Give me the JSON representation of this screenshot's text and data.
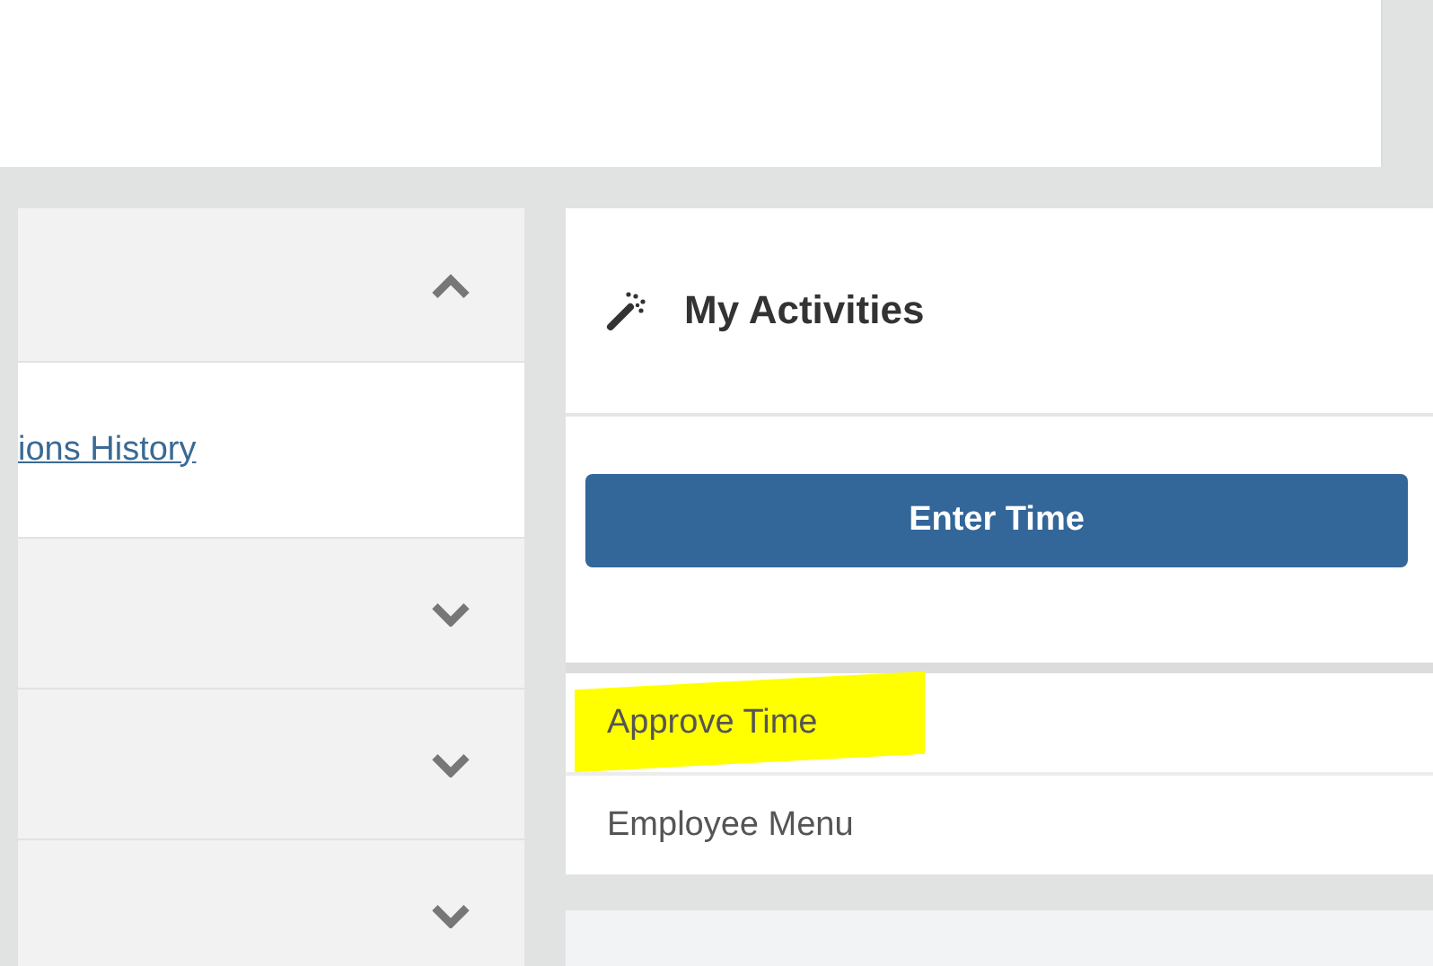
{
  "accordion": [
    {
      "expanded": true,
      "links": [
        "ions History"
      ]
    },
    {
      "expanded": false
    },
    {
      "expanded": false
    },
    {
      "expanded": false
    }
  ],
  "activities": {
    "title": "My Activities",
    "button": "Enter Time",
    "items": [
      {
        "label": "Approve Time",
        "highlighted": true
      },
      {
        "label": "Employee Menu",
        "highlighted": false
      }
    ]
  }
}
